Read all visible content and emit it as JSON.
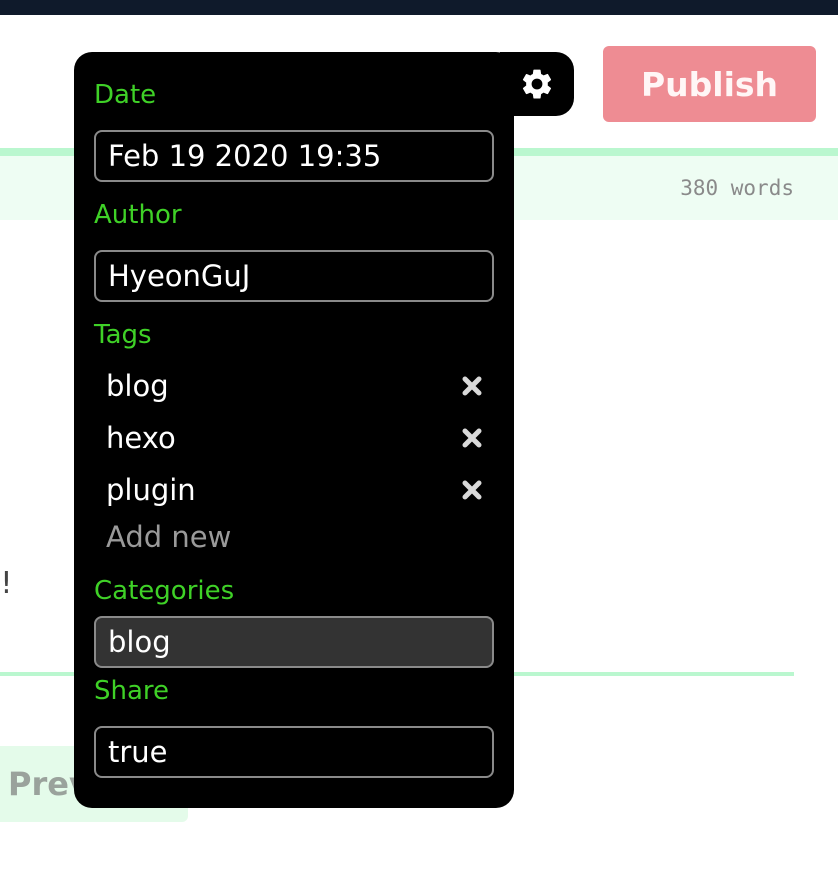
{
  "header": {
    "publish_label": "Publish"
  },
  "editor": {
    "word_count": "380 words",
    "partial_text": "l!",
    "preview_label": "Prev"
  },
  "settings": {
    "gear_icon": "gear-icon",
    "date": {
      "label": "Date",
      "value": "Feb 19 2020 19:35"
    },
    "author": {
      "label": "Author",
      "value": "HyeonGuJ"
    },
    "tags": {
      "label": "Tags",
      "items": [
        "blog",
        "hexo",
        "plugin"
      ],
      "add_new_placeholder": "Add new",
      "remove_icon": "close-icon"
    },
    "categories": {
      "label": "Categories",
      "value": "blog"
    },
    "share": {
      "label": "Share",
      "value": "true"
    }
  },
  "colors": {
    "label_green": "#3fd127",
    "publish_bg": "#ee8c93",
    "accent_mint": "#baf7cf",
    "panel_bg": "#000000"
  }
}
